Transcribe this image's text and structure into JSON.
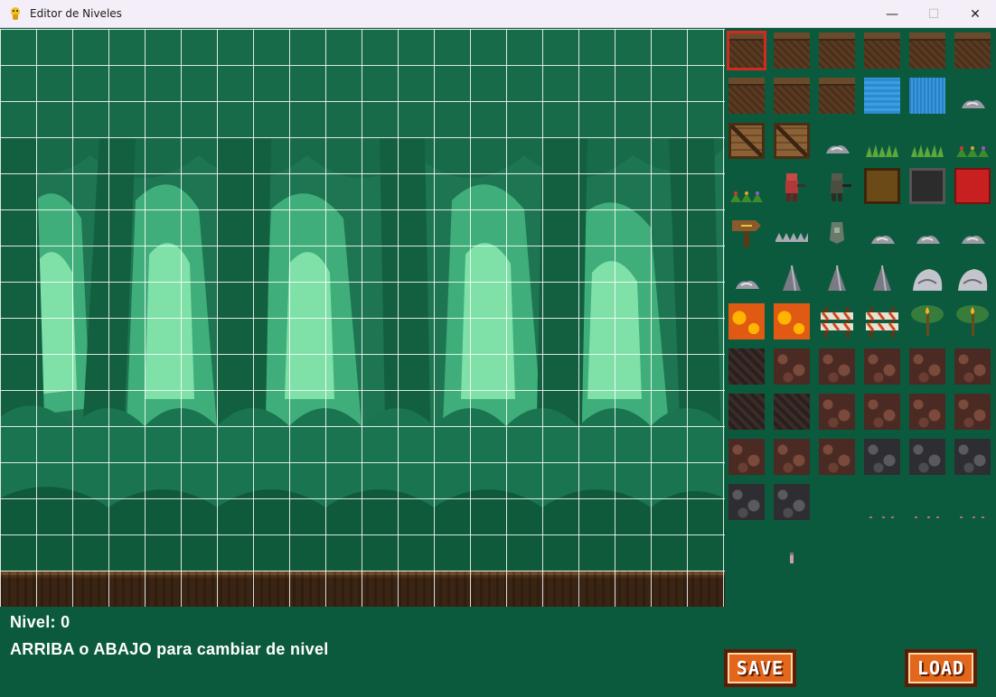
{
  "window": {
    "title": "Editor de Niveles",
    "controls": {
      "minimize": "—",
      "maximize": "☐",
      "close": "✕"
    }
  },
  "editor": {
    "level_label": "Nivel: 0",
    "instructions": "ARRIBA o ABAJO para cambiar de nivel",
    "selected_tile_index": 0,
    "grid": {
      "columns": 20,
      "rows": 16
    }
  },
  "palette": {
    "columns": 6,
    "tiles": [
      "dirt-tile",
      "dirt-tile",
      "dirt-tile",
      "dirt-tile",
      "dirt-tile",
      "dirt-tile",
      "dirt-tile",
      "dirt-tile",
      "dirt-tile",
      "water-tile",
      "water-tile",
      "stone-pile",
      "crate-tile",
      "crate-tile",
      "stone-pile",
      "grass-tile",
      "grass-tile",
      "flowers-tile",
      "flowers-tile",
      "player-soldier",
      "enemy-soldier",
      "ammo-box",
      "grenade-box",
      "health-box",
      "signpost",
      "spikes",
      "armor",
      "stone-pile",
      "stone-pile",
      "stone-pile",
      "stone-pile",
      "stone-spire",
      "stone-spire",
      "stone-spire",
      "boulder",
      "boulder",
      "lava-tile",
      "lava-tile",
      "barricade",
      "barricade",
      "torch",
      "torch",
      "dark-rock",
      "brown-rock",
      "brown-rock",
      "brown-rock",
      "brown-rock",
      "brown-rock-slope",
      "dark-rock-slope",
      "dark-rock-slope",
      "brown-rock",
      "brown-rock-plant",
      "brown-rock",
      "brown-rock",
      "brown-rock",
      "brown-rock",
      "brown-rock",
      "gray-rock",
      "gray-rock",
      "gray-rock",
      "gray-rock",
      "gray-rock",
      "blank",
      "debris",
      "debris",
      "debris",
      "blank",
      "small-item",
      "blank",
      "blank",
      "blank",
      "blank"
    ]
  },
  "buttons": {
    "save": "SAVE",
    "load": "LOAD"
  },
  "colors": {
    "background": "#0c5a3e",
    "grid": "#ffffff",
    "selection": "#d22a20",
    "button": "#e2661c"
  }
}
